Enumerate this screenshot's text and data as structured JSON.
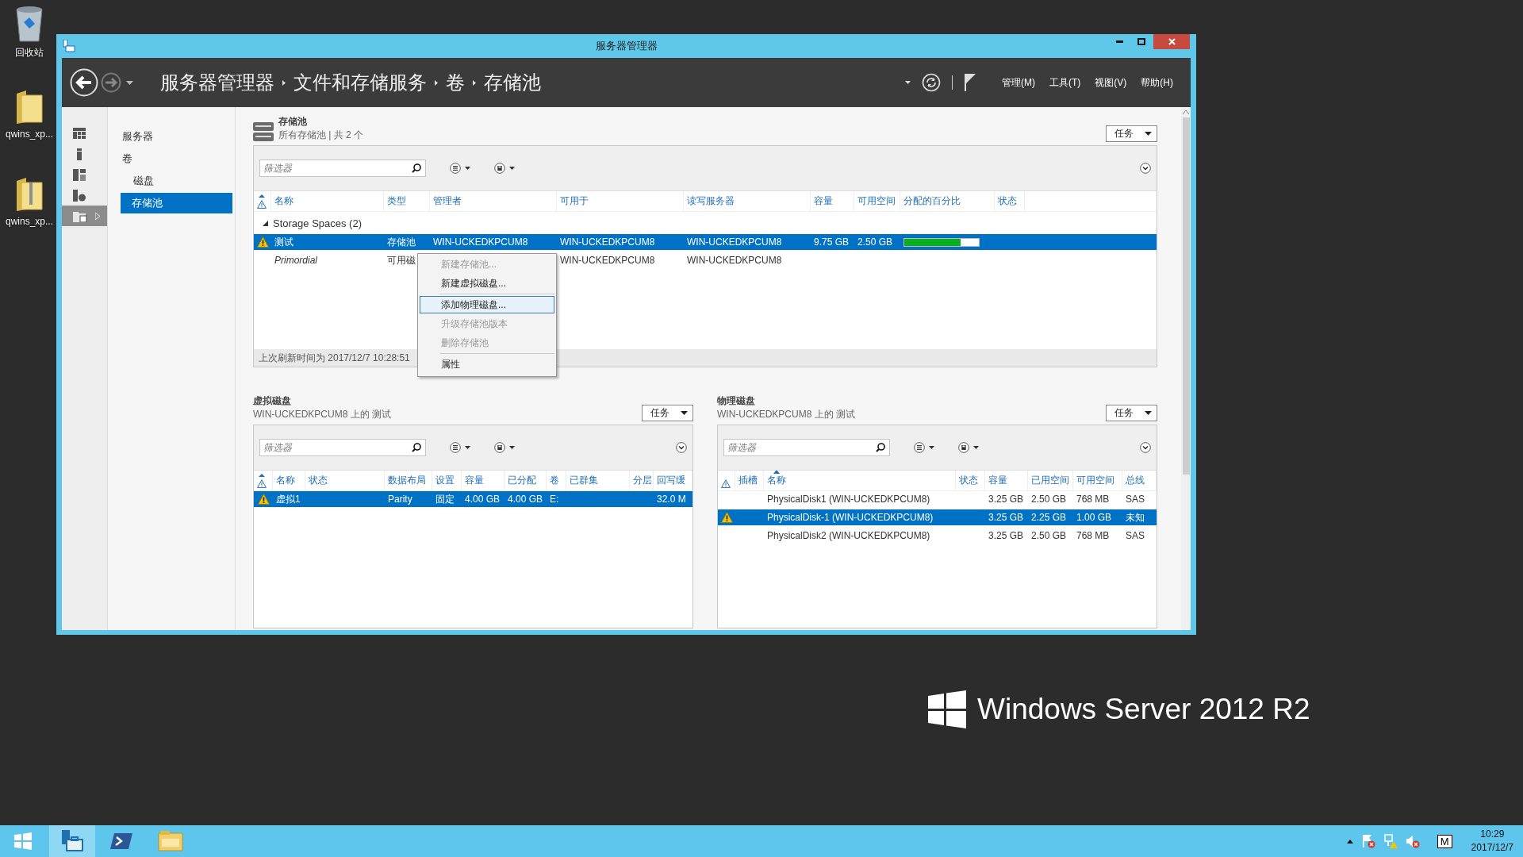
{
  "desktop_icons": [
    {
      "kind": "recycle",
      "label": "回收站"
    },
    {
      "kind": "folder",
      "label": "qwins_xp..."
    },
    {
      "kind": "zip",
      "label": "qwins_xp..."
    }
  ],
  "window": {
    "title": "服务器管理器"
  },
  "breadcrumb": [
    "服务器管理器",
    "文件和存储服务",
    "卷",
    "存储池"
  ],
  "menu": [
    "管理(M)",
    "工具(T)",
    "视图(V)",
    "帮助(H)"
  ],
  "rail": [
    {
      "kind": "dashboard",
      "selected": false
    },
    {
      "kind": "server",
      "selected": false
    },
    {
      "kind": "servers",
      "selected": false
    },
    {
      "kind": "role",
      "selected": false
    },
    {
      "kind": "storage",
      "selected": true
    }
  ],
  "nav": [
    {
      "label": "服务器",
      "selected": false
    },
    {
      "label": "卷",
      "selected": false,
      "children": [
        {
          "label": "磁盘",
          "selected": false
        },
        {
          "label": "存储池",
          "selected": true
        }
      ]
    }
  ],
  "pools": {
    "title": "存储池",
    "subtitle": "所有存储池 | 共 2 个",
    "tasks": "任务",
    "filter_placeholder": "筛选器",
    "columns": [
      {
        "kind": "warning",
        "sorted": true
      },
      {
        "kind": "text",
        "label": "名称",
        "sorted": false
      },
      {
        "kind": "text",
        "label": "类型",
        "sorted": false
      },
      {
        "kind": "text",
        "label": "管理者",
        "sorted": false
      },
      {
        "kind": "text",
        "label": "可用于",
        "sorted": false
      },
      {
        "kind": "text",
        "label": "读写服务器",
        "sorted": false
      },
      {
        "kind": "text",
        "label": "容量",
        "sorted": false
      },
      {
        "kind": "text",
        "label": "可用空间",
        "sorted": false
      },
      {
        "kind": "text",
        "label": "分配的百分比",
        "sorted": false
      },
      {
        "kind": "text",
        "label": "状态",
        "sorted": false
      }
    ],
    "group": {
      "label": "Storage Spaces (2)",
      "expanded": true
    },
    "rows": [
      {
        "warning": true,
        "selected": true,
        "italic": false,
        "name": "测试",
        "type": "存储池",
        "manager": "WIN-UCKEDKPCUM8",
        "available_to": "WIN-UCKEDKPCUM8",
        "rw_server": "WIN-UCKEDKPCUM8",
        "capacity": "9.75 GB",
        "free_space": "2.50 GB",
        "level": 0.76
      },
      {
        "warning": false,
        "selected": false,
        "italic": true,
        "name": "Primordial",
        "type": "可用磁",
        "available_to": "WIN-UCKEDKPCUM8",
        "rw_server": "WIN-UCKEDKPCUM8"
      }
    ],
    "footer": "上次刷新时间为 2017/12/7 10:28:51"
  },
  "context_menu": {
    "items": [
      {
        "kind": "item",
        "label": "新建存储池...",
        "disabled": true,
        "selected": false
      },
      {
        "kind": "item",
        "label": "新建虚拟磁盘...",
        "disabled": false,
        "selected": false
      },
      {
        "kind": "separator"
      },
      {
        "kind": "item",
        "label": "添加物理磁盘...",
        "disabled": false,
        "selected": true
      },
      {
        "kind": "item",
        "label": "升级存储池版本",
        "disabled": true,
        "selected": false
      },
      {
        "kind": "item",
        "label": "删除存储池",
        "disabled": true,
        "selected": false
      },
      {
        "kind": "separator"
      },
      {
        "kind": "item",
        "label": "属性",
        "disabled": false,
        "selected": false
      }
    ]
  },
  "virtual_disks": {
    "title": "虚拟磁盘",
    "subtitle": "WIN-UCKEDKPCUM8 上的 测试",
    "tasks": "任务",
    "filter_placeholder": "筛选器",
    "columns": [
      {
        "kind": "warning",
        "sorted": true
      },
      {
        "kind": "text",
        "label": "名称",
        "sorted": false
      },
      {
        "kind": "text",
        "label": "状态",
        "sorted": false
      },
      {
        "kind": "text",
        "label": "数据布局",
        "sorted": false
      },
      {
        "kind": "text",
        "label": "设置",
        "sorted": false
      },
      {
        "kind": "text",
        "label": "容量",
        "sorted": false
      },
      {
        "kind": "text",
        "label": "已分配",
        "sorted": false
      },
      {
        "kind": "text",
        "label": "卷",
        "sorted": false
      },
      {
        "kind": "text",
        "label": "已群集",
        "sorted": false
      },
      {
        "kind": "text",
        "label": "分层",
        "sorted": false
      },
      {
        "kind": "text",
        "label": "回写缓",
        "sorted": false
      }
    ],
    "rows": [
      {
        "warning": true,
        "selected": true,
        "italic": false,
        "name": "虚拟1",
        "layout": "Parity",
        "provisioning": "固定",
        "capacity": "4.00 GB",
        "allocated": "4.00 GB",
        "volume": "E:",
        "write_cache": "32.0 M"
      }
    ]
  },
  "physical_disks": {
    "title": "物理磁盘",
    "subtitle": "WIN-UCKEDKPCUM8 上的 测试",
    "tasks": "任务",
    "filter_placeholder": "筛选器",
    "columns": [
      {
        "kind": "warning",
        "sorted": false
      },
      {
        "kind": "text",
        "label": "插槽",
        "sorted": false
      },
      {
        "kind": "text",
        "label": "名称",
        "sorted": true
      },
      {
        "kind": "text",
        "label": "状态",
        "sorted": false
      },
      {
        "kind": "text",
        "label": "容量",
        "sorted": false
      },
      {
        "kind": "text",
        "label": "已用空间",
        "sorted": false
      },
      {
        "kind": "text",
        "label": "可用空间",
        "sorted": false
      },
      {
        "kind": "text",
        "label": "总线",
        "sorted": false
      }
    ],
    "rows": [
      {
        "warning": false,
        "selected": false,
        "italic": false,
        "name": "PhysicalDisk1 (WIN-UCKEDKPCUM8)",
        "capacity": "3.25 GB",
        "used": "2.50 GB",
        "free": "768 MB",
        "bus": "SAS"
      },
      {
        "warning": true,
        "selected": true,
        "italic": false,
        "name": "PhysicalDisk-1 (WIN-UCKEDKPCUM8)",
        "capacity": "3.25 GB",
        "used": "2.25 GB",
        "free": "1.00 GB",
        "bus": "未知"
      },
      {
        "warning": false,
        "selected": false,
        "italic": false,
        "name": "PhysicalDisk2 (WIN-UCKEDKPCUM8)",
        "capacity": "3.25 GB",
        "used": "2.50 GB",
        "free": "768 MB",
        "bus": "SAS"
      }
    ]
  },
  "brand": "Windows Server 2012 R2",
  "taskbar": {
    "items": [
      {
        "kind": "start",
        "selected": false
      },
      {
        "kind": "server-manager",
        "selected": true
      },
      {
        "kind": "powershell",
        "selected": false
      },
      {
        "kind": "explorer",
        "selected": false
      }
    ],
    "ime": "M",
    "time": "10:29",
    "date": "2017/12/7"
  }
}
